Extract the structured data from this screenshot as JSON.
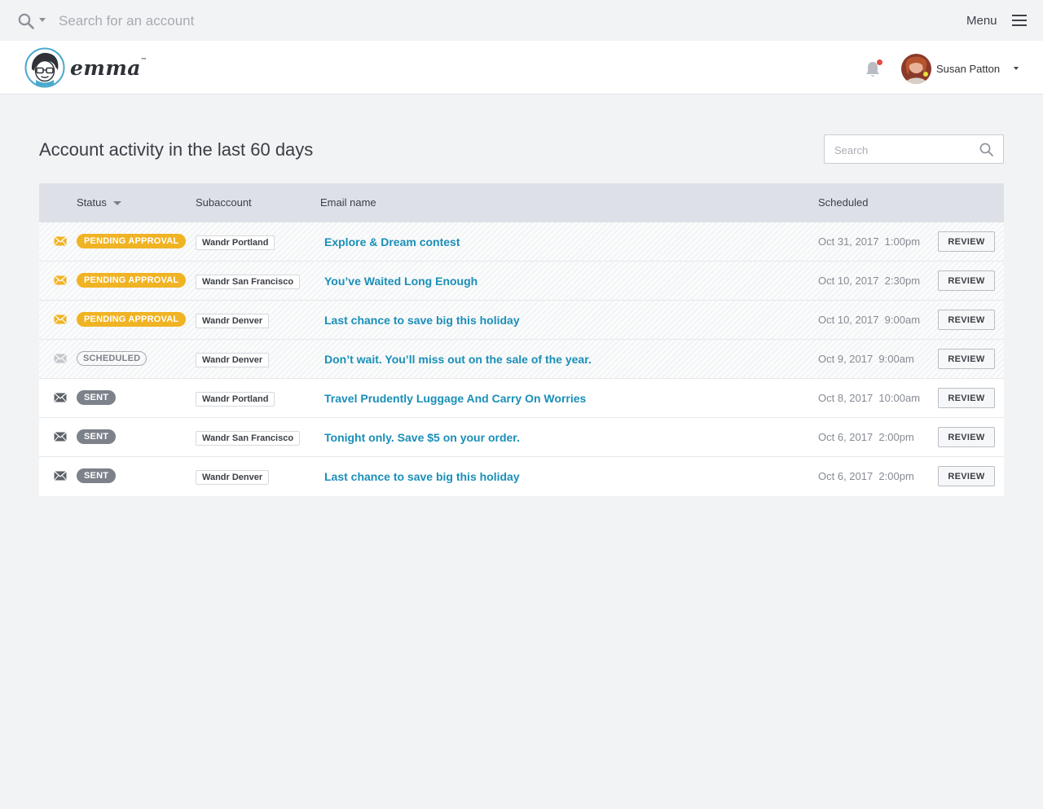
{
  "topbar": {
    "search_placeholder": "Search for an account",
    "menu_label": "Menu"
  },
  "header": {
    "logo_text": "emma",
    "user_name": "Susan Patton",
    "notification_dot_color": "#e9473f"
  },
  "page": {
    "title": "Account activity in the last 60 days",
    "search_placeholder": "Search"
  },
  "table": {
    "columns": {
      "status": "Status",
      "subaccount": "Subaccount",
      "email_name": "Email name",
      "scheduled": "Scheduled"
    },
    "rows": [
      {
        "status": "PENDING APPROVAL",
        "status_type": "pending",
        "subaccount": "Wandr Portland",
        "email_name": "Explore & Dream contest",
        "scheduled": "Oct 31, 2017  1:00pm",
        "action": "REVIEW"
      },
      {
        "status": "PENDING APPROVAL",
        "status_type": "pending",
        "subaccount": "Wandr San Francisco",
        "email_name": "You’ve Waited Long Enough",
        "scheduled": "Oct 10, 2017  2:30pm",
        "action": "REVIEW"
      },
      {
        "status": "PENDING APPROVAL",
        "status_type": "pending",
        "subaccount": "Wandr Denver",
        "email_name": "Last chance to save big this holiday",
        "scheduled": "Oct 10, 2017  9:00am",
        "action": "REVIEW"
      },
      {
        "status": "SCHEDULED",
        "status_type": "scheduled",
        "subaccount": "Wandr Denver",
        "email_name": "Don’t wait. You’ll miss out on the sale of the year.",
        "scheduled": "Oct 9, 2017  9:00am",
        "action": "REVIEW"
      },
      {
        "status": "SENT",
        "status_type": "sent",
        "subaccount": "Wandr Portland",
        "email_name": "Travel Prudently Luggage And Carry On Worries",
        "scheduled": "Oct 8, 2017  10:00am",
        "action": "REVIEW"
      },
      {
        "status": "SENT",
        "status_type": "sent",
        "subaccount": "Wandr San Francisco",
        "email_name": "Tonight only. Save $5 on your order.",
        "scheduled": "Oct 6, 2017  2:00pm",
        "action": "REVIEW"
      },
      {
        "status": "SENT",
        "status_type": "sent",
        "subaccount": "Wandr Denver",
        "email_name": "Last chance to save big this holiday",
        "scheduled": "Oct 6, 2017  2:00pm",
        "action": "REVIEW"
      }
    ]
  },
  "colors": {
    "pending": "#f0b323",
    "sent": "#7d8189",
    "link": "#1a8fb8",
    "header_row": "#dde1e7",
    "background": "#f2f3f5"
  },
  "icons": {
    "top_search": "search-icon",
    "menu": "hamburger-icon",
    "notifications": "bell-icon",
    "row_status": "envelope-icon",
    "table_search": "search-icon"
  }
}
